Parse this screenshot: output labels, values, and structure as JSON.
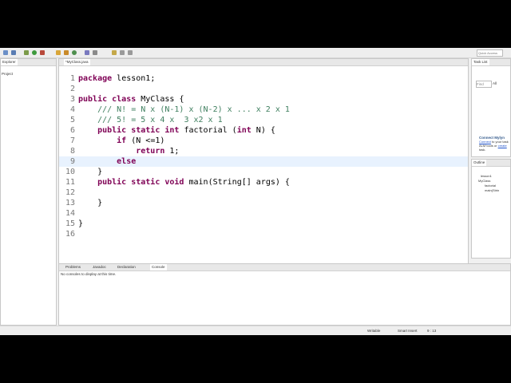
{
  "toolbar": {
    "quick_access": "Quick Access"
  },
  "explorer": {
    "tab_label": "Explorer",
    "project": "Project"
  },
  "editor": {
    "tab_label": "*MyClass.java",
    "lines": [
      {
        "n": "1",
        "segs": [
          {
            "t": "package ",
            "c": "kw"
          },
          {
            "t": "lesson1;",
            "c": ""
          }
        ]
      },
      {
        "n": "2",
        "segs": []
      },
      {
        "n": "3",
        "segs": [
          {
            "t": "public class ",
            "c": "kw"
          },
          {
            "t": "MyClass {",
            "c": ""
          }
        ]
      },
      {
        "n": "4",
        "segs": [
          {
            "t": "    /// N! = N x (N-1) x (N-2) x ... x 2 x 1",
            "c": "cm"
          }
        ]
      },
      {
        "n": "5",
        "segs": [
          {
            "t": "    /// 5! = 5 x 4 x  3 x2 x 1",
            "c": "cm"
          }
        ]
      },
      {
        "n": "6",
        "segs": [
          {
            "t": "    public static int ",
            "c": "kw"
          },
          {
            "t": "factorial ",
            "c": ""
          },
          {
            "t": "(",
            "c": ""
          },
          {
            "t": "int ",
            "c": "kw"
          },
          {
            "t": "N) {",
            "c": ""
          }
        ]
      },
      {
        "n": "7",
        "segs": [
          {
            "t": "        if ",
            "c": "kw"
          },
          {
            "t": "(N <=1)",
            "c": ""
          }
        ]
      },
      {
        "n": "8",
        "segs": [
          {
            "t": "            return ",
            "c": "kw"
          },
          {
            "t": "1;",
            "c": ""
          }
        ]
      },
      {
        "n": "9",
        "segs": [
          {
            "t": "        else",
            "c": "kw"
          }
        ]
      },
      {
        "n": "10",
        "segs": [
          {
            "t": "    }",
            "c": ""
          }
        ]
      },
      {
        "n": "11",
        "segs": [
          {
            "t": "    public static void ",
            "c": "kw"
          },
          {
            "t": "main(String[] args) {",
            "c": ""
          }
        ]
      },
      {
        "n": "12",
        "segs": []
      },
      {
        "n": "13",
        "segs": [
          {
            "t": "    }",
            "c": ""
          }
        ]
      },
      {
        "n": "14",
        "segs": []
      },
      {
        "n": "15",
        "segs": [
          {
            "t": "}",
            "c": ""
          }
        ]
      },
      {
        "n": "16",
        "segs": []
      }
    ]
  },
  "tasklist": {
    "tab_label": "Task List",
    "find_placeholder": "Find",
    "find_all": "All"
  },
  "mylyn": {
    "title": "Connect Mylyn",
    "connect_link": "Connect",
    "text1": " to your task",
    "text2": "ALM tools or ",
    "create_link": "create",
    "text3": "task."
  },
  "outline": {
    "tab_label": "Outline",
    "items": [
      {
        "label": "lesson1"
      },
      {
        "label": "MyClass"
      },
      {
        "label": "factorial"
      },
      {
        "label": "main(Strin"
      }
    ]
  },
  "console": {
    "tabs": [
      "Problems",
      "Javadoc",
      "Declaration",
      "Console"
    ],
    "active_tab": "Console",
    "message": "No consoles to display at this time."
  },
  "status": {
    "writable": "Writable",
    "insert_mode": "Smart Insert",
    "position": "9 : 13"
  }
}
